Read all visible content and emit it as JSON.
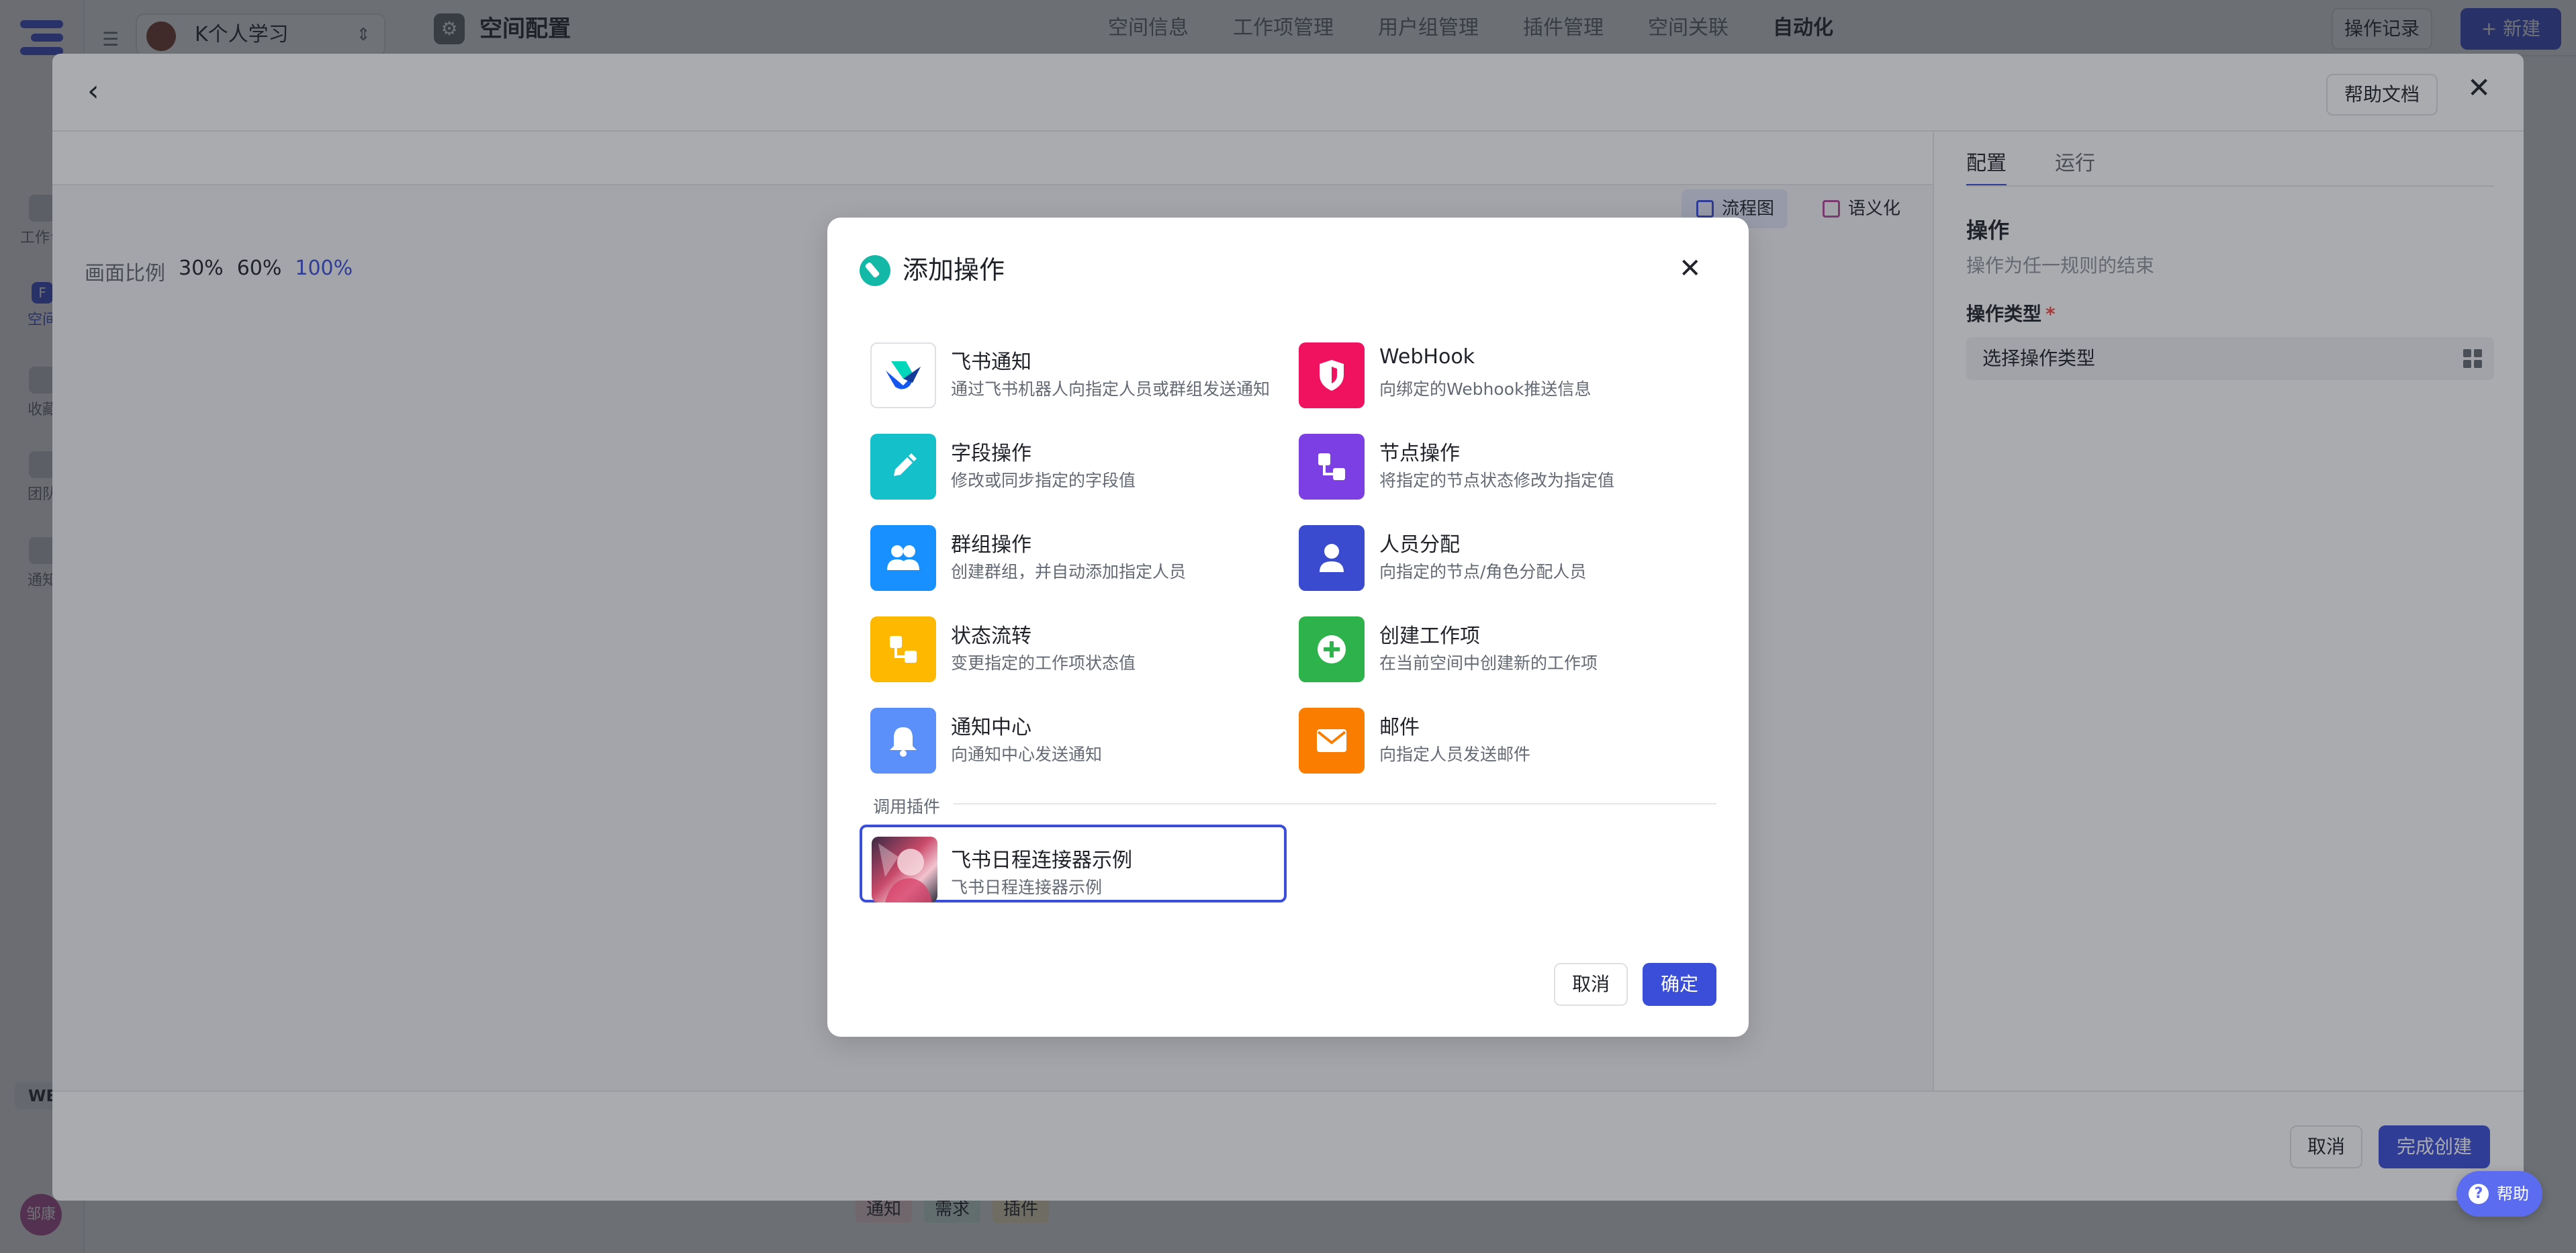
{
  "app": {
    "project_name": "K个人学习",
    "page_title": "空间配置",
    "nav": [
      "空间信息",
      "工作项管理",
      "用户组管理",
      "插件管理",
      "空间关联",
      "自动化"
    ],
    "nav_active": "自动化",
    "log_button": "操作记录",
    "new_button": "新建",
    "sidebar_items": [
      {
        "label": "工作台",
        "icon": "home-icon"
      },
      {
        "label": "空间",
        "icon": "space-icon"
      },
      {
        "label": "收藏",
        "icon": "star-icon"
      },
      {
        "label": "团队",
        "icon": "team-icon"
      },
      {
        "label": "通知",
        "icon": "bell-icon"
      }
    ],
    "workspace_badge": "WB",
    "avatar_text": "邹康",
    "bg_tags": [
      "通知",
      "需求",
      "插件"
    ]
  },
  "editor": {
    "help_doc": "帮助文档",
    "views": [
      {
        "label": "流程图",
        "active": true
      },
      {
        "label": "语义化",
        "active": false
      }
    ],
    "zoom_label": "画面比例",
    "zoom_levels": [
      "30%",
      "60%",
      "100%"
    ],
    "zoom_active": "100%",
    "panel_tabs": [
      "配置",
      "运行"
    ],
    "panel_tab_active": "配置",
    "section_title": "操作",
    "section_subtitle": "操作为任一规则的结束",
    "type_label": "操作类型",
    "required_mark": "*",
    "type_placeholder": "选择操作类型",
    "footer_cancel": "取消",
    "footer_done": "完成创建"
  },
  "modal": {
    "title": "添加操作",
    "operations": [
      {
        "name": "飞书通知",
        "desc": "通过飞书机器人向指定人员或群组发送通知",
        "icon": "feishu-logo-icon",
        "color": "#ffffff"
      },
      {
        "name": "WebHook",
        "desc": "向绑定的Webhook推送信息",
        "icon": "shield-icon",
        "color": "#f0115f"
      },
      {
        "name": "字段操作",
        "desc": "修改或同步指定的字段值",
        "icon": "pencil-icon",
        "color": "#14c0c9"
      },
      {
        "name": "节点操作",
        "desc": "将指定的节点状态修改为指定值",
        "icon": "node-flow-icon",
        "color": "#7b3fe4"
      },
      {
        "name": "群组操作",
        "desc": "创建群组，并自动添加指定人员",
        "icon": "group-icon",
        "color": "#1890ff"
      },
      {
        "name": "人员分配",
        "desc": "向指定的节点/角色分配人员",
        "icon": "person-icon",
        "color": "#3b4bd0"
      },
      {
        "name": "状态流转",
        "desc": "变更指定的工作项状态值",
        "icon": "status-flow-icon",
        "color": "#ffb800"
      },
      {
        "name": "创建工作项",
        "desc": "在当前空间中创建新的工作项",
        "icon": "plus-circle-icon",
        "color": "#2eb24c"
      },
      {
        "name": "通知中心",
        "desc": "向通知中心发送通知",
        "icon": "bell-icon",
        "color": "#5b8ff9"
      },
      {
        "name": "邮件",
        "desc": "向指定人员发送邮件",
        "icon": "mail-icon",
        "color": "#fa7d00"
      }
    ],
    "plugin_section_label": "调用插件",
    "plugins": [
      {
        "name": "飞书日程连接器示例",
        "desc": "飞书日程连接器示例",
        "icon": "plugin-avatar-icon",
        "selected": true
      }
    ],
    "cancel": "取消",
    "confirm": "确定"
  },
  "help_fab": "帮助"
}
